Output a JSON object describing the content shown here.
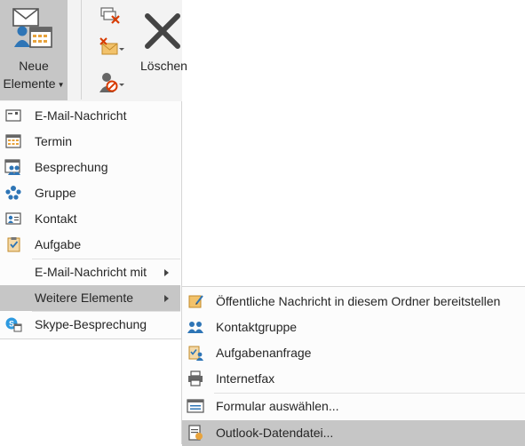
{
  "ribbon": {
    "new_items_line1": "Neue",
    "new_items_line2": "Elemente",
    "delete_label": "Löschen"
  },
  "menu": {
    "items": [
      {
        "label": "E-Mail-Nachricht",
        "icon": "mail-icon"
      },
      {
        "label": "Termin",
        "icon": "calendar-icon"
      },
      {
        "label": "Besprechung",
        "icon": "meeting-icon"
      },
      {
        "label": "Gruppe",
        "icon": "group-icon"
      },
      {
        "label": "Kontakt",
        "icon": "contact-card-icon"
      },
      {
        "label": "Aufgabe",
        "icon": "task-clipboard-icon"
      },
      {
        "label": "E-Mail-Nachricht mit",
        "icon": null
      },
      {
        "label": "Weitere Elemente",
        "icon": null
      },
      {
        "label": "Skype-Besprechung",
        "icon": "skype-icon"
      }
    ]
  },
  "submenu": {
    "items": [
      {
        "label": "Öffentliche Nachricht in diesem Ordner bereitstellen",
        "icon": "post-note-icon"
      },
      {
        "label": "Kontaktgruppe",
        "icon": "contact-group-icon"
      },
      {
        "label": "Aufgabenanfrage",
        "icon": "task-request-icon"
      },
      {
        "label": "Internetfax",
        "icon": "fax-printer-icon"
      },
      {
        "label": "Formular auswählen...",
        "icon": "form-icon"
      },
      {
        "label": "Outlook-Datendatei...",
        "icon": "data-file-icon"
      }
    ]
  },
  "colors": {
    "highlight": "#c6c6c6",
    "ribbon_bg": "#f3f3f3",
    "accent_blue": "#2e75b6",
    "accent_orange": "#e8a33c",
    "delete_red": "#d83b01"
  }
}
